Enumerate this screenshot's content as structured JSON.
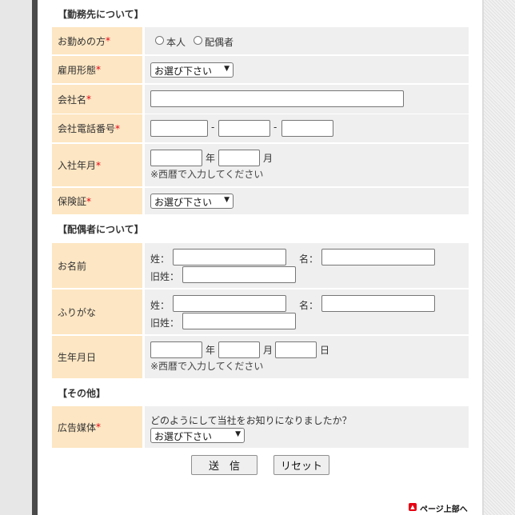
{
  "sections": {
    "employer": "【勤務先について】",
    "spouse": "【配偶者について】",
    "other": "【その他】"
  },
  "required_mark": "*",
  "employer": {
    "employment_target": {
      "label": "お勤めの方",
      "options": [
        "本人",
        "配偶者"
      ]
    },
    "employment_type": {
      "label": "雇用形態",
      "selected": "お選び下さい"
    },
    "company_name": {
      "label": "会社名",
      "value": ""
    },
    "company_phone": {
      "label": "会社電話番号",
      "separator": "-"
    },
    "join_date": {
      "label": "入社年月",
      "year_unit": "年",
      "month_unit": "月",
      "note": "※西暦で入力してください"
    },
    "insurance": {
      "label": "保険証",
      "selected": "お選び下さい"
    }
  },
  "spouse": {
    "name": {
      "label": "お名前",
      "sei": "姓：",
      "mei": "名：",
      "former": "旧姓："
    },
    "kana": {
      "label": "ふりがな",
      "sei": "姓：",
      "mei": "名：",
      "former": "旧姓："
    },
    "birthdate": {
      "label": "生年月日",
      "year_unit": "年",
      "month_unit": "月",
      "day_unit": "日",
      "note": "※西暦で入力してください"
    }
  },
  "other": {
    "ad_media": {
      "label": "広告媒体",
      "question": "どのようにして当社をお知りになりましたか？",
      "selected": "お選び下さい"
    }
  },
  "buttons": {
    "submit": "送　信",
    "reset": "リセット"
  },
  "page_top": "ページ上部へ",
  "colors": {
    "label_bg": "#fde6c3",
    "cell_bg": "#efefef",
    "required": "#e60012"
  }
}
